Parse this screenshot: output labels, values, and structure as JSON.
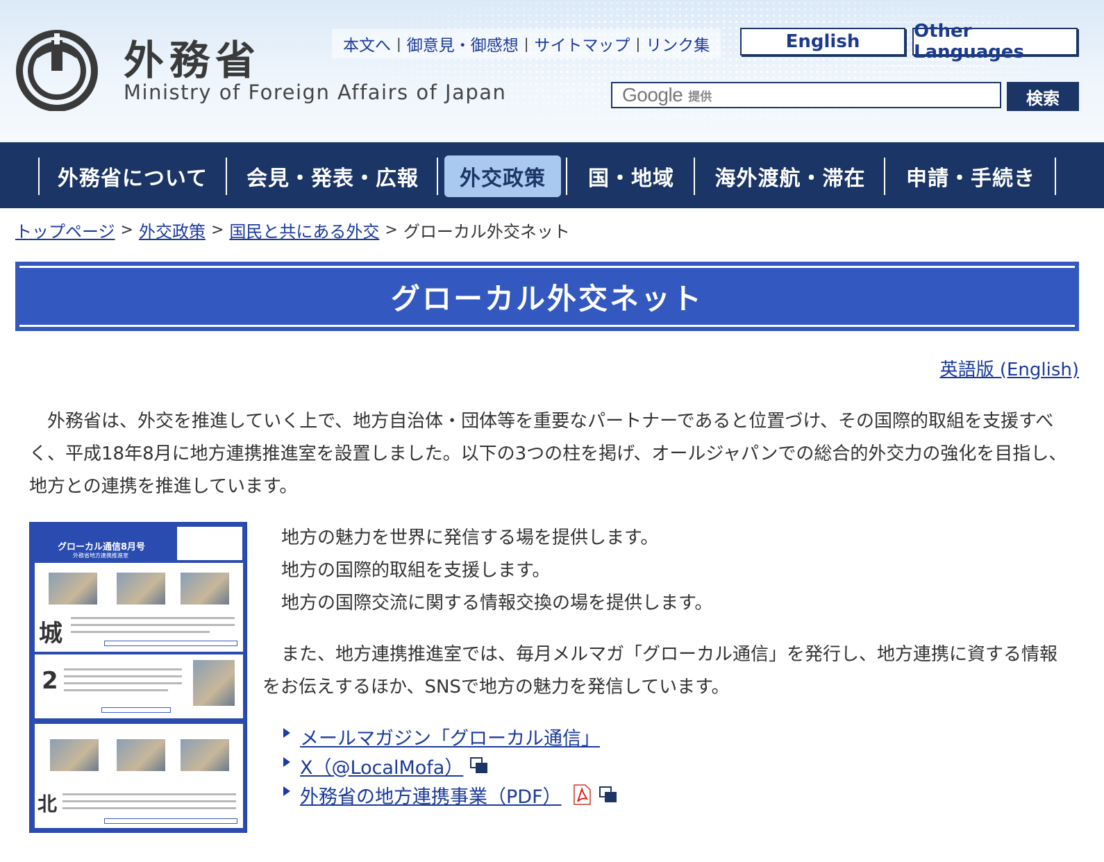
{
  "header": {
    "logo_jp": "外務省",
    "logo_en": "Ministry of Foreign Affairs of Japan",
    "util_links": [
      "本文へ",
      "御意見・御感想",
      "サイトマップ",
      "リンク集"
    ],
    "lang_english": "English",
    "lang_other": "Other Languages",
    "search": {
      "brand": "Google",
      "provided": "提供",
      "value": "",
      "button": "検索"
    }
  },
  "nav": {
    "items": [
      "外務省について",
      "会見・発表・広報",
      "外交政策",
      "国・地域",
      "海外渡航・滞在",
      "申請・手続き"
    ],
    "active": "外交政策"
  },
  "breadcrumb": {
    "items": [
      "トップページ",
      "外交政策",
      "国民と共にある外交"
    ],
    "current": "グローカル外交ネット",
    "sep": ">"
  },
  "page": {
    "title": "グローカル外交ネット",
    "english_link": "英語版 (English)",
    "intro": "外務省は、外交を推進していく上で、地方自治体・団体等を重要なパートナーであると位置づけ、その国際的取組を支援すべく、平成18年8月に地方連携推進室を設置しました。以下の3つの柱を掲げ、オールジャパンでの総合的外交力の強化を目指し、地方との連携を推進しています。",
    "pillars": [
      "地方の魅力を世界に発信する場を提供します。",
      "地方の国際的取組を支援します。",
      "地方の国際交流に関する情報交換の場を提供します。"
    ],
    "para2": "また、地方連携推進室では、毎月メルマガ「グローカル通信」を発行し、地方連携に資する情報をお伝えするほか、SNSで地方の魅力を発信しています。",
    "links": [
      {
        "label": "メールマガジン「グローカル通信」"
      },
      {
        "label": "X（@LocalMofa）"
      },
      {
        "label": "外務省の地方連携事業（PDF）"
      }
    ]
  },
  "thumbnail": {
    "title": "グローカル通信8月号",
    "subtitle": "外務省地方連携推進室",
    "section_chars": [
      "城",
      "2",
      "北"
    ]
  },
  "colors": {
    "nav_bg": "#1b3566",
    "nav_active": "#a9c9f0",
    "title_bg": "#3359c0",
    "link": "#1a3a9c"
  }
}
